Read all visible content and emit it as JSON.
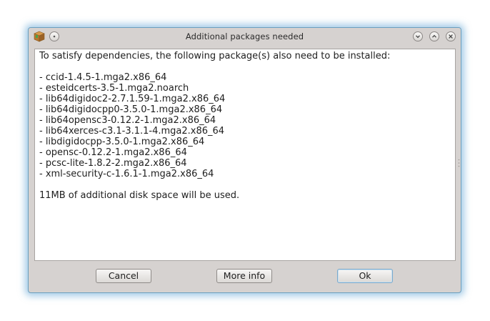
{
  "window": {
    "title": "Additional packages needed"
  },
  "titlebar": {
    "app_icon": "package-box-icon",
    "menu_icon": "window-menu-dot-icon",
    "buttons": [
      "minimize-icon",
      "maximize-icon",
      "close-icon"
    ]
  },
  "message": {
    "intro": "To satisfy dependencies, the following package(s) also need to be installed:",
    "packages": [
      "- ccid-1.4.5-1.mga2.x86_64",
      "- esteidcerts-3.5-1.mga2.noarch",
      "- lib64digidoc2-2.7.1.59-1.mga2.x86_64",
      "- lib64digidocpp0-3.5.0-1.mga2.x86_64",
      "- lib64opensc3-0.12.2-1.mga2.x86_64",
      "- lib64xerces-c3.1-3.1.1-4.mga2.x86_64",
      "- libdigidocpp-3.5.0-1.mga2.x86_64",
      "- opensc-0.12.2-1.mga2.x86_64",
      "- pcsc-lite-1.8.2-2.mga2.x86_64",
      "- xml-security-c-1.6.1-1.mga2.x86_64"
    ],
    "disk_space": "11MB of additional disk space will be used."
  },
  "buttons": {
    "cancel": "Cancel",
    "more_info": "More info",
    "ok": "Ok"
  },
  "colors": {
    "window_glow": "#5aa0d2",
    "window_bg": "#d6d2d0",
    "default_button_border": "#7aa9cc"
  }
}
